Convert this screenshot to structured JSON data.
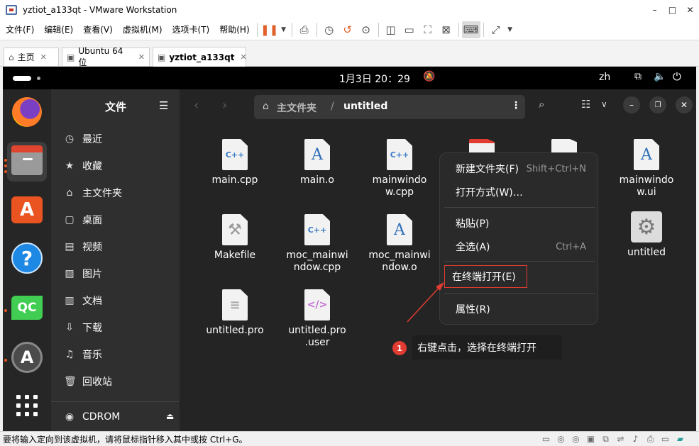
{
  "window": {
    "title": "yztiot_a133qt - VMware Workstation",
    "ctrl_min": "–",
    "ctrl_max": "□",
    "ctrl_close": "✕"
  },
  "menubar": [
    "文件(F)",
    "编辑(E)",
    "查看(V)",
    "虚拟机(M)",
    "选项卡(T)",
    "帮助(H)"
  ],
  "tabs": [
    {
      "label": "主页"
    },
    {
      "label": "Ubuntu 64 位"
    },
    {
      "label": "yztiot_a133qt"
    }
  ],
  "topbar": {
    "clock": "1月3日  20：29",
    "lang": "zh"
  },
  "sidebar": {
    "title": "文件",
    "items": [
      {
        "label": "最近",
        "icon": "clock-icon"
      },
      {
        "label": "收藏",
        "icon": "star-icon"
      },
      {
        "label": "主文件夹",
        "icon": "home-icon"
      },
      {
        "label": "桌面",
        "icon": "desktop-icon"
      },
      {
        "label": "视频",
        "icon": "video-icon"
      },
      {
        "label": "图片",
        "icon": "picture-icon"
      },
      {
        "label": "文档",
        "icon": "document-icon"
      },
      {
        "label": "下载",
        "icon": "download-icon"
      },
      {
        "label": "音乐",
        "icon": "music-icon"
      },
      {
        "label": "回收站",
        "icon": "trash-icon"
      }
    ],
    "device": "CDROM"
  },
  "pathbar": {
    "home": "主文件夹",
    "separator": "/",
    "current": "untitled"
  },
  "files": [
    {
      "name": "main.cpp",
      "type": "cpp"
    },
    {
      "name": "main.o",
      "type": "object"
    },
    {
      "name": "mainwindo\nw.cpp",
      "type": "cpp"
    },
    {
      "name": "mainwindo\nw.ui",
      "type": "object"
    },
    {
      "name": "Makefile",
      "type": "makefile"
    },
    {
      "name": "moc_mainwi\nndow.cpp",
      "type": "cpp"
    },
    {
      "name": "moc_mainwi\nndow.o",
      "type": "object"
    },
    {
      "name": "untitled",
      "type": "executable"
    },
    {
      "name": "untitled.pro",
      "type": "text"
    },
    {
      "name": "untitled.pro\n.user",
      "type": "xml"
    }
  ],
  "icon_labels": {
    "cpp": "C++",
    "object": "A",
    "xml": "</>"
  },
  "context_menu": {
    "new_folder": "新建文件夹(F)",
    "new_folder_shortcut": "Shift+Ctrl+N",
    "open_with": "打开方式(W)…",
    "paste": "粘贴(P)",
    "select_all": "全选(A)",
    "select_all_shortcut": "Ctrl+A",
    "open_in_terminal": "在终端打开(E)",
    "properties": "属性(R)"
  },
  "annotation": {
    "number": "1",
    "text": "右键点击，选择在终端打开"
  },
  "statusbar": {
    "message": "要将输入定向到该虚拟机，请将鼠标指针移入其中或按 Ctrl+G。"
  },
  "colors": {
    "accent": "#e95420",
    "annotation_red": "#e03c31"
  }
}
